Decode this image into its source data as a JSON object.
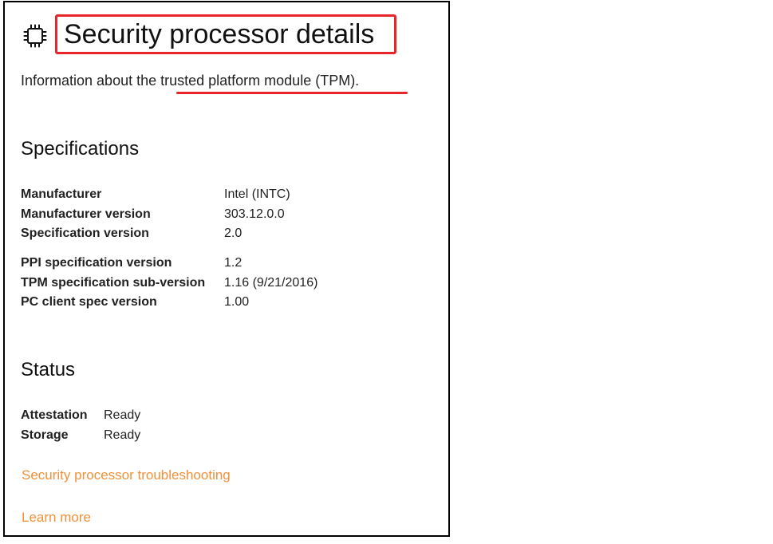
{
  "header": {
    "icon": "processor-chip-icon",
    "title": "Security processor details",
    "intro": "Information about the trusted platform module (TPM)."
  },
  "specifications": {
    "heading": "Specifications",
    "group1": [
      {
        "key": "Manufacturer",
        "value": "Intel (INTC)"
      },
      {
        "key": "Manufacturer version",
        "value": "303.12.0.0"
      },
      {
        "key": "Specification version",
        "value": "2.0"
      }
    ],
    "group2": [
      {
        "key": "PPI specification version",
        "value": "1.2"
      },
      {
        "key": "TPM specification sub-version",
        "value": "1.16 (9/21/2016)"
      },
      {
        "key": "PC client spec version",
        "value": "1.00"
      }
    ]
  },
  "status": {
    "heading": "Status",
    "rows": [
      {
        "key": "Attestation",
        "value": "Ready"
      },
      {
        "key": "Storage",
        "value": "Ready"
      }
    ]
  },
  "links": {
    "troubleshooting": "Security processor troubleshooting",
    "learn_more": "Learn more"
  },
  "colors": {
    "annotation": "#e8252b",
    "link": "#f0913a",
    "border": "#000000"
  }
}
